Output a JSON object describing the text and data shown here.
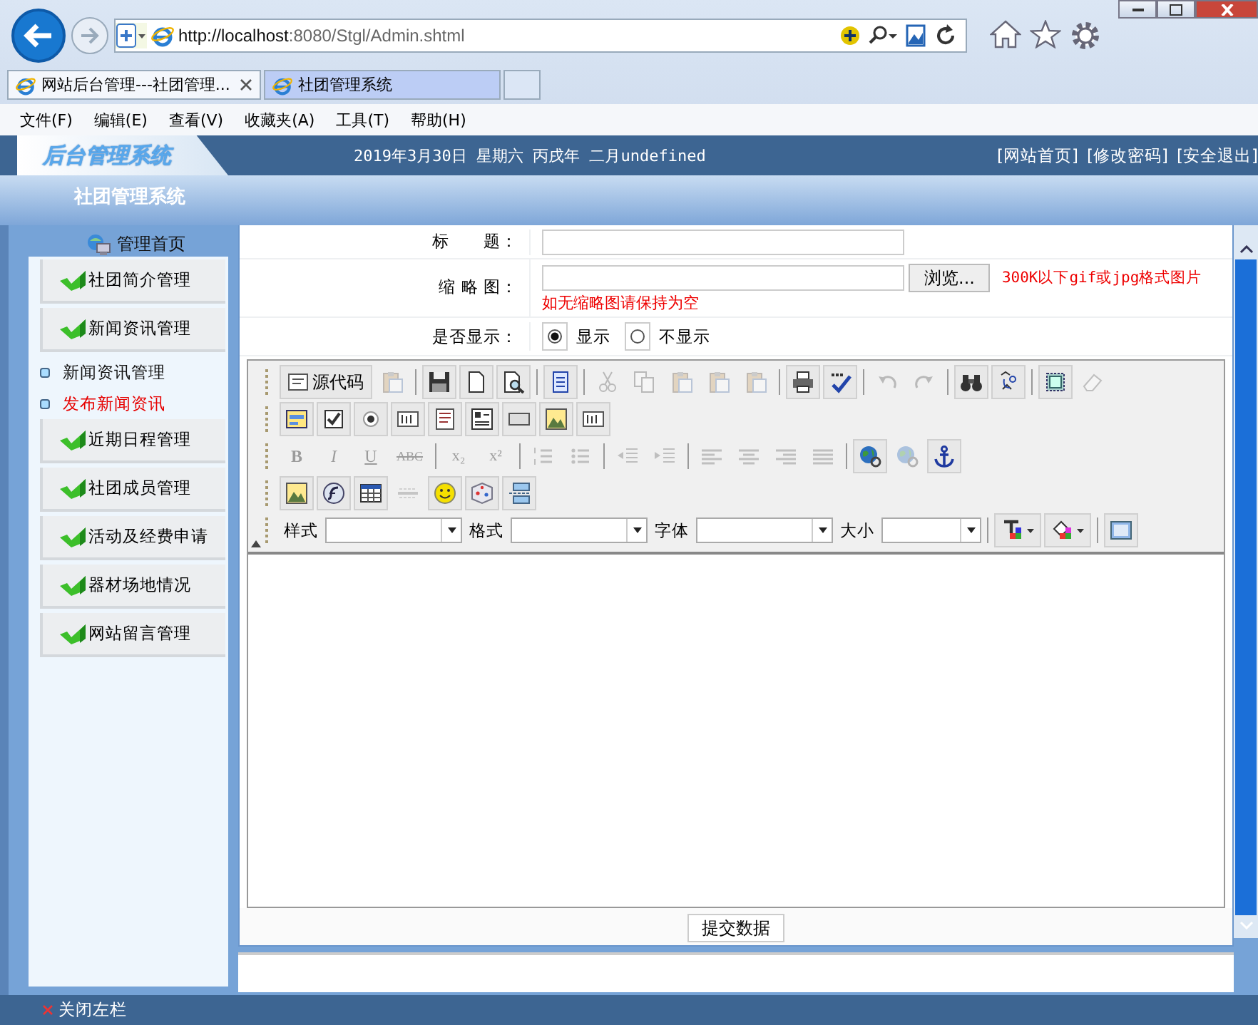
{
  "browser": {
    "address_host": "http://localhost",
    "address_rest": ":8080/Stgl/Admin.shtml",
    "tabs": [
      {
        "title": "网站后台管理---社团管理...",
        "selected": true,
        "closable": true
      },
      {
        "title": "社团管理系统",
        "selected": false,
        "closable": false
      }
    ],
    "menu": [
      "文件(F)",
      "编辑(E)",
      "查看(V)",
      "收藏夹(A)",
      "工具(T)",
      "帮助(H)"
    ]
  },
  "header": {
    "logo": "后台管理系统",
    "date": "2019年3月30日 星期六 丙戌年 二月undefined",
    "links": [
      "[网站首页]",
      "[修改密码]",
      "[安全退出]"
    ],
    "subtitle": "社团管理系统"
  },
  "sidebar": {
    "home": "管理首页",
    "items": [
      {
        "kind": "section",
        "label": "社团简介管理"
      },
      {
        "kind": "section",
        "label": "新闻资讯管理"
      },
      {
        "kind": "link",
        "label": "新闻资讯管理",
        "selected": false
      },
      {
        "kind": "link",
        "label": "发布新闻资讯",
        "selected": true
      },
      {
        "kind": "section",
        "label": "近期日程管理"
      },
      {
        "kind": "section",
        "label": "社团成员管理"
      },
      {
        "kind": "section",
        "label": "活动及经费申请"
      },
      {
        "kind": "section",
        "label": "器材场地情况"
      },
      {
        "kind": "section",
        "label": "网站留言管理"
      }
    ]
  },
  "form": {
    "title_label": "标　　题：",
    "thumb_label": "缩 略 图：",
    "browse": "浏览...",
    "thumb_hint": "300K以下gif或jpg格式图片",
    "thumb_note": "如无缩略图请保持为空",
    "show_label": "是否显示：",
    "show_options": [
      {
        "label": "显示",
        "selected": true
      },
      {
        "label": "不显示",
        "selected": false
      }
    ]
  },
  "editor": {
    "toolbars": [
      {
        "items": [
          {
            "kind": "text",
            "label": "源代码",
            "disabled": false
          },
          {
            "kind": "icon",
            "disabled": true
          },
          {
            "kind": "sep"
          },
          {
            "kind": "icon",
            "disabled": false
          },
          {
            "kind": "icon",
            "disabled": false
          },
          {
            "kind": "icon",
            "disabled": false
          },
          {
            "kind": "sep"
          },
          {
            "kind": "icon",
            "disabled": false
          },
          {
            "kind": "sep"
          },
          {
            "kind": "icon",
            "disabled": true
          },
          {
            "kind": "icon",
            "disabled": true
          },
          {
            "kind": "icon",
            "disabled": true
          },
          {
            "kind": "icon",
            "disabled": true
          },
          {
            "kind": "icon",
            "disabled": true
          },
          {
            "kind": "sep"
          },
          {
            "kind": "icon",
            "disabled": false
          },
          {
            "kind": "icon",
            "disabled": false
          },
          {
            "kind": "sep"
          },
          {
            "kind": "icon",
            "disabled": true
          },
          {
            "kind": "icon",
            "disabled": true
          },
          {
            "kind": "sep"
          },
          {
            "kind": "icon",
            "disabled": false
          },
          {
            "kind": "icon",
            "disabled": false
          },
          {
            "kind": "sep"
          },
          {
            "kind": "icon",
            "disabled": false
          },
          {
            "kind": "icon",
            "disabled": true
          }
        ]
      },
      {
        "items": [
          {
            "kind": "icon",
            "disabled": false
          },
          {
            "kind": "icon",
            "disabled": false
          },
          {
            "kind": "icon",
            "disabled": false
          },
          {
            "kind": "icon",
            "disabled": false
          },
          {
            "kind": "icon",
            "disabled": false
          },
          {
            "kind": "icon",
            "disabled": false
          },
          {
            "kind": "icon",
            "disabled": false
          },
          {
            "kind": "icon",
            "disabled": false
          },
          {
            "kind": "icon",
            "disabled": false
          }
        ]
      },
      {
        "items": [
          {
            "kind": "glyph",
            "label": "B",
            "disabled": true
          },
          {
            "kind": "glyph",
            "label": "I",
            "disabled": true
          },
          {
            "kind": "glyph",
            "label": "U",
            "disabled": true
          },
          {
            "kind": "glyph",
            "label": "ABC",
            "disabled": true
          },
          {
            "kind": "sep"
          },
          {
            "kind": "glyph",
            "label": "x₂",
            "disabled": true
          },
          {
            "kind": "glyph",
            "label": "x²",
            "disabled": true
          },
          {
            "kind": "sep"
          },
          {
            "kind": "icon",
            "disabled": true
          },
          {
            "kind": "icon",
            "disabled": true
          },
          {
            "kind": "sep"
          },
          {
            "kind": "icon",
            "disabled": true
          },
          {
            "kind": "icon",
            "disabled": true
          },
          {
            "kind": "sep"
          },
          {
            "kind": "icon",
            "disabled": true
          },
          {
            "kind": "icon",
            "disabled": true
          },
          {
            "kind": "icon",
            "disabled": true
          },
          {
            "kind": "icon",
            "disabled": true
          },
          {
            "kind": "sep"
          },
          {
            "kind": "icon",
            "disabled": false
          },
          {
            "kind": "icon",
            "disabled": true
          },
          {
            "kind": "icon",
            "disabled": false
          }
        ]
      },
      {
        "items": [
          {
            "kind": "icon",
            "disabled": false
          },
          {
            "kind": "icon",
            "disabled": false
          },
          {
            "kind": "icon",
            "disabled": false
          },
          {
            "kind": "icon",
            "disabled": true
          },
          {
            "kind": "icon",
            "disabled": false
          },
          {
            "kind": "icon",
            "disabled": false
          },
          {
            "kind": "icon",
            "disabled": false
          }
        ]
      },
      {
        "items": [
          {
            "kind": "combo",
            "label": "样式"
          },
          {
            "kind": "combo",
            "label": "格式"
          },
          {
            "kind": "combo",
            "label": "字体"
          },
          {
            "kind": "combo",
            "label": "大小"
          },
          {
            "kind": "sep"
          },
          {
            "kind": "menu",
            "disabled": false
          },
          {
            "kind": "menu",
            "disabled": false
          },
          {
            "kind": "sep"
          },
          {
            "kind": "icon",
            "disabled": false
          }
        ]
      }
    ]
  },
  "submit": "提交数据",
  "footer": {
    "close_left": "关闭左栏"
  }
}
